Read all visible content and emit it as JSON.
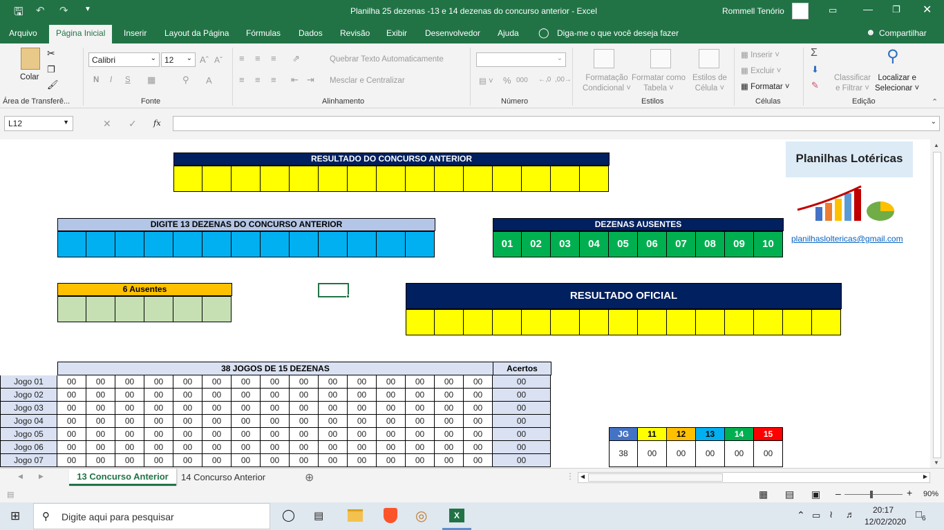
{
  "window": {
    "title": "Planilha 25 dezenas -13 e 14 dezenas do concurso anterior  -  Excel",
    "user": "Rommell Tenório"
  },
  "tabs": [
    "Arquivo",
    "Página Inicial",
    "Inserir",
    "Layout da Página",
    "Fórmulas",
    "Dados",
    "Revisão",
    "Exibir",
    "Desenvolvedor",
    "Ajuda"
  ],
  "tell_me": "Diga-me o que você deseja fazer",
  "share": "Compartilhar",
  "ribbon": {
    "paste": "Colar",
    "font_name": "Calibri",
    "font_size": "12",
    "bold": "N",
    "italic": "I",
    "underline": "S",
    "wrap_text": "Quebrar Texto Automaticamente",
    "merge_center": "Mesclar e Centralizar",
    "number_format": "",
    "percent": "%",
    "thousands": "000",
    "cond_format_1": "Formatação",
    "cond_format_2": "Condicional",
    "format_table_1": "Formatar como",
    "format_table_2": "Tabela",
    "cell_styles_1": "Estilos de",
    "cell_styles_2": "Célula",
    "insert": "Inserir",
    "delete": "Excluir",
    "format": "Formatar",
    "sort_1": "Classificar",
    "sort_2": "e Filtrar",
    "find_1": "Localizar e",
    "find_2": "Selecionar",
    "groups": [
      "Área de Transferê...",
      "Fonte",
      "Alinhamento",
      "Número",
      "Estilos",
      "Células",
      "Edição"
    ]
  },
  "formula_bar": {
    "name_box": "L12",
    "fx": "fx",
    "formula": ""
  },
  "sheet": {
    "resultado_anterior_title": "RESULTADO DO CONCURSO ANTERIOR",
    "digite_title": "DIGITE 13 DEZENAS DO CONCURSO ANTERIOR",
    "ausentes_title": "DEZENAS AUSENTES",
    "ausentes": [
      "01",
      "02",
      "03",
      "04",
      "05",
      "06",
      "07",
      "08",
      "09",
      "10"
    ],
    "seis_ausentes_title": "6 Ausentes",
    "resultado_oficial_title": "RESULTADO OFICIAL",
    "brand_title": "Planilhas Lotéricas",
    "brand_email": "planilhasloltericas@gmail.com",
    "jogos_title": "38 JOGOS DE 15 DEZENAS",
    "acertos_title": "Acertos",
    "jogos": [
      {
        "label": "Jogo 01",
        "values": [
          "00",
          "00",
          "00",
          "00",
          "00",
          "00",
          "00",
          "00",
          "00",
          "00",
          "00",
          "00",
          "00",
          "00",
          "00"
        ],
        "acertos": "00"
      },
      {
        "label": "Jogo 02",
        "values": [
          "00",
          "00",
          "00",
          "00",
          "00",
          "00",
          "00",
          "00",
          "00",
          "00",
          "00",
          "00",
          "00",
          "00",
          "00"
        ],
        "acertos": "00"
      },
      {
        "label": "Jogo 03",
        "values": [
          "00",
          "00",
          "00",
          "00",
          "00",
          "00",
          "00",
          "00",
          "00",
          "00",
          "00",
          "00",
          "00",
          "00",
          "00"
        ],
        "acertos": "00"
      },
      {
        "label": "Jogo 04",
        "values": [
          "00",
          "00",
          "00",
          "00",
          "00",
          "00",
          "00",
          "00",
          "00",
          "00",
          "00",
          "00",
          "00",
          "00",
          "00"
        ],
        "acertos": "00"
      },
      {
        "label": "Jogo 05",
        "values": [
          "00",
          "00",
          "00",
          "00",
          "00",
          "00",
          "00",
          "00",
          "00",
          "00",
          "00",
          "00",
          "00",
          "00",
          "00"
        ],
        "acertos": "00"
      },
      {
        "label": "Jogo 06",
        "values": [
          "00",
          "00",
          "00",
          "00",
          "00",
          "00",
          "00",
          "00",
          "00",
          "00",
          "00",
          "00",
          "00",
          "00",
          "00"
        ],
        "acertos": "00"
      },
      {
        "label": "Jogo 07",
        "values": [
          "00",
          "00",
          "00",
          "00",
          "00",
          "00",
          "00",
          "00",
          "00",
          "00",
          "00",
          "00",
          "00",
          "00",
          "00"
        ],
        "acertos": "00"
      }
    ],
    "summary": {
      "headers": [
        {
          "text": "JG",
          "color": "#4472c4",
          "fg": "#ffffff"
        },
        {
          "text": "11",
          "color": "#ffff00",
          "fg": "#000000"
        },
        {
          "text": "12",
          "color": "#ffc000",
          "fg": "#000000"
        },
        {
          "text": "13",
          "color": "#00b0f0",
          "fg": "#000000"
        },
        {
          "text": "14",
          "color": "#00b050",
          "fg": "#ffffff"
        },
        {
          "text": "15",
          "color": "#ff0000",
          "fg": "#ffffff"
        }
      ],
      "values": [
        "38",
        "00",
        "00",
        "00",
        "00",
        "00"
      ]
    }
  },
  "sheet_tabs": [
    "13 Concurso Anterior",
    "14 Concurso Anterior"
  ],
  "status": {
    "zoom": "90%"
  },
  "taskbar": {
    "search": "Digite aqui para pesquisar",
    "time": "20:17",
    "date": "12/02/2020",
    "notif": "6"
  },
  "colors": {
    "excel_green": "#217346",
    "navy": "#002060",
    "yellow": "#ffff00",
    "cyan": "#00b0f0",
    "green": "#00b050",
    "orange": "#ffc000",
    "light_green": "#c6e0b4",
    "light_blue": "#b4c6e7"
  }
}
